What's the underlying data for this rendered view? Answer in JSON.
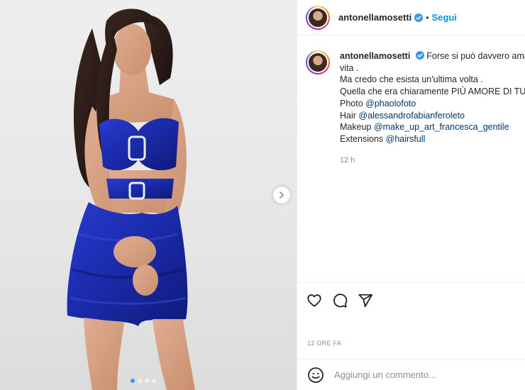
{
  "post": {
    "username": "antonellamosetti",
    "verified": true,
    "follow_label": "Segui",
    "separator": "•"
  },
  "caption": {
    "username": "antonellamosetti",
    "line1": "Forse si può davvero amare",
    "line2": "vita .",
    "line3": "Ma credo che esista un'ultima volta .",
    "line4": "Quella che era chiaramente PIÙ AMORE DI TUTTE",
    "credits": [
      {
        "prefix": "Photo ",
        "mention": "@phaolofoto"
      },
      {
        "prefix": "Hair ",
        "mention": "@alessandrofabianferoleto"
      },
      {
        "prefix": "Makeup ",
        "mention": "@make_up_art_francesca_gentile"
      },
      {
        "prefix": "Extensions ",
        "mention": "@hairsfull"
      }
    ],
    "age": "12 h"
  },
  "timestamp": "12 ORE FA",
  "comment_box": {
    "placeholder": "Aggiungi un commento..."
  },
  "icons": {
    "like": "heart-icon",
    "comment": "comment-icon",
    "share": "share-icon",
    "emoji": "emoji-icon",
    "next": "chevron-right-icon",
    "verified": "verified-badge-icon"
  },
  "colors": {
    "accent": "#0095f6",
    "dress": "#1d2fb8",
    "mention": "#00376b"
  },
  "carousel": {
    "slides": 4,
    "active_index": 0
  }
}
